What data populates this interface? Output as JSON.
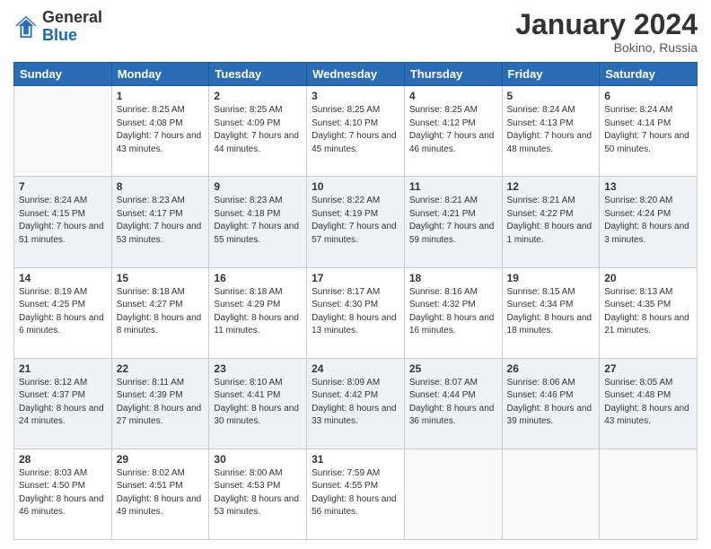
{
  "header": {
    "logo_line1": "General",
    "logo_line2": "Blue",
    "month_title": "January 2024",
    "location": "Bokino, Russia"
  },
  "days_of_week": [
    "Sunday",
    "Monday",
    "Tuesday",
    "Wednesday",
    "Thursday",
    "Friday",
    "Saturday"
  ],
  "weeks": [
    [
      {
        "day": "",
        "sunrise": "",
        "sunset": "",
        "daylight": ""
      },
      {
        "day": "1",
        "sunrise": "Sunrise: 8:25 AM",
        "sunset": "Sunset: 4:08 PM",
        "daylight": "Daylight: 7 hours and 43 minutes."
      },
      {
        "day": "2",
        "sunrise": "Sunrise: 8:25 AM",
        "sunset": "Sunset: 4:09 PM",
        "daylight": "Daylight: 7 hours and 44 minutes."
      },
      {
        "day": "3",
        "sunrise": "Sunrise: 8:25 AM",
        "sunset": "Sunset: 4:10 PM",
        "daylight": "Daylight: 7 hours and 45 minutes."
      },
      {
        "day": "4",
        "sunrise": "Sunrise: 8:25 AM",
        "sunset": "Sunset: 4:12 PM",
        "daylight": "Daylight: 7 hours and 46 minutes."
      },
      {
        "day": "5",
        "sunrise": "Sunrise: 8:24 AM",
        "sunset": "Sunset: 4:13 PM",
        "daylight": "Daylight: 7 hours and 48 minutes."
      },
      {
        "day": "6",
        "sunrise": "Sunrise: 8:24 AM",
        "sunset": "Sunset: 4:14 PM",
        "daylight": "Daylight: 7 hours and 50 minutes."
      }
    ],
    [
      {
        "day": "7",
        "sunrise": "Sunrise: 8:24 AM",
        "sunset": "Sunset: 4:15 PM",
        "daylight": "Daylight: 7 hours and 51 minutes."
      },
      {
        "day": "8",
        "sunrise": "Sunrise: 8:23 AM",
        "sunset": "Sunset: 4:17 PM",
        "daylight": "Daylight: 7 hours and 53 minutes."
      },
      {
        "day": "9",
        "sunrise": "Sunrise: 8:23 AM",
        "sunset": "Sunset: 4:18 PM",
        "daylight": "Daylight: 7 hours and 55 minutes."
      },
      {
        "day": "10",
        "sunrise": "Sunrise: 8:22 AM",
        "sunset": "Sunset: 4:19 PM",
        "daylight": "Daylight: 7 hours and 57 minutes."
      },
      {
        "day": "11",
        "sunrise": "Sunrise: 8:21 AM",
        "sunset": "Sunset: 4:21 PM",
        "daylight": "Daylight: 7 hours and 59 minutes."
      },
      {
        "day": "12",
        "sunrise": "Sunrise: 8:21 AM",
        "sunset": "Sunset: 4:22 PM",
        "daylight": "Daylight: 8 hours and 1 minute."
      },
      {
        "day": "13",
        "sunrise": "Sunrise: 8:20 AM",
        "sunset": "Sunset: 4:24 PM",
        "daylight": "Daylight: 8 hours and 3 minutes."
      }
    ],
    [
      {
        "day": "14",
        "sunrise": "Sunrise: 8:19 AM",
        "sunset": "Sunset: 4:25 PM",
        "daylight": "Daylight: 8 hours and 6 minutes."
      },
      {
        "day": "15",
        "sunrise": "Sunrise: 8:18 AM",
        "sunset": "Sunset: 4:27 PM",
        "daylight": "Daylight: 8 hours and 8 minutes."
      },
      {
        "day": "16",
        "sunrise": "Sunrise: 8:18 AM",
        "sunset": "Sunset: 4:29 PM",
        "daylight": "Daylight: 8 hours and 11 minutes."
      },
      {
        "day": "17",
        "sunrise": "Sunrise: 8:17 AM",
        "sunset": "Sunset: 4:30 PM",
        "daylight": "Daylight: 8 hours and 13 minutes."
      },
      {
        "day": "18",
        "sunrise": "Sunrise: 8:16 AM",
        "sunset": "Sunset: 4:32 PM",
        "daylight": "Daylight: 8 hours and 16 minutes."
      },
      {
        "day": "19",
        "sunrise": "Sunrise: 8:15 AM",
        "sunset": "Sunset: 4:34 PM",
        "daylight": "Daylight: 8 hours and 18 minutes."
      },
      {
        "day": "20",
        "sunrise": "Sunrise: 8:13 AM",
        "sunset": "Sunset: 4:35 PM",
        "daylight": "Daylight: 8 hours and 21 minutes."
      }
    ],
    [
      {
        "day": "21",
        "sunrise": "Sunrise: 8:12 AM",
        "sunset": "Sunset: 4:37 PM",
        "daylight": "Daylight: 8 hours and 24 minutes."
      },
      {
        "day": "22",
        "sunrise": "Sunrise: 8:11 AM",
        "sunset": "Sunset: 4:39 PM",
        "daylight": "Daylight: 8 hours and 27 minutes."
      },
      {
        "day": "23",
        "sunrise": "Sunrise: 8:10 AM",
        "sunset": "Sunset: 4:41 PM",
        "daylight": "Daylight: 8 hours and 30 minutes."
      },
      {
        "day": "24",
        "sunrise": "Sunrise: 8:09 AM",
        "sunset": "Sunset: 4:42 PM",
        "daylight": "Daylight: 8 hours and 33 minutes."
      },
      {
        "day": "25",
        "sunrise": "Sunrise: 8:07 AM",
        "sunset": "Sunset: 4:44 PM",
        "daylight": "Daylight: 8 hours and 36 minutes."
      },
      {
        "day": "26",
        "sunrise": "Sunrise: 8:06 AM",
        "sunset": "Sunset: 4:46 PM",
        "daylight": "Daylight: 8 hours and 39 minutes."
      },
      {
        "day": "27",
        "sunrise": "Sunrise: 8:05 AM",
        "sunset": "Sunset: 4:48 PM",
        "daylight": "Daylight: 8 hours and 43 minutes."
      }
    ],
    [
      {
        "day": "28",
        "sunrise": "Sunrise: 8:03 AM",
        "sunset": "Sunset: 4:50 PM",
        "daylight": "Daylight: 8 hours and 46 minutes."
      },
      {
        "day": "29",
        "sunrise": "Sunrise: 8:02 AM",
        "sunset": "Sunset: 4:51 PM",
        "daylight": "Daylight: 8 hours and 49 minutes."
      },
      {
        "day": "30",
        "sunrise": "Sunrise: 8:00 AM",
        "sunset": "Sunset: 4:53 PM",
        "daylight": "Daylight: 8 hours and 53 minutes."
      },
      {
        "day": "31",
        "sunrise": "Sunrise: 7:59 AM",
        "sunset": "Sunset: 4:55 PM",
        "daylight": "Daylight: 8 hours and 56 minutes."
      },
      {
        "day": "",
        "sunrise": "",
        "sunset": "",
        "daylight": ""
      },
      {
        "day": "",
        "sunrise": "",
        "sunset": "",
        "daylight": ""
      },
      {
        "day": "",
        "sunrise": "",
        "sunset": "",
        "daylight": ""
      }
    ]
  ]
}
